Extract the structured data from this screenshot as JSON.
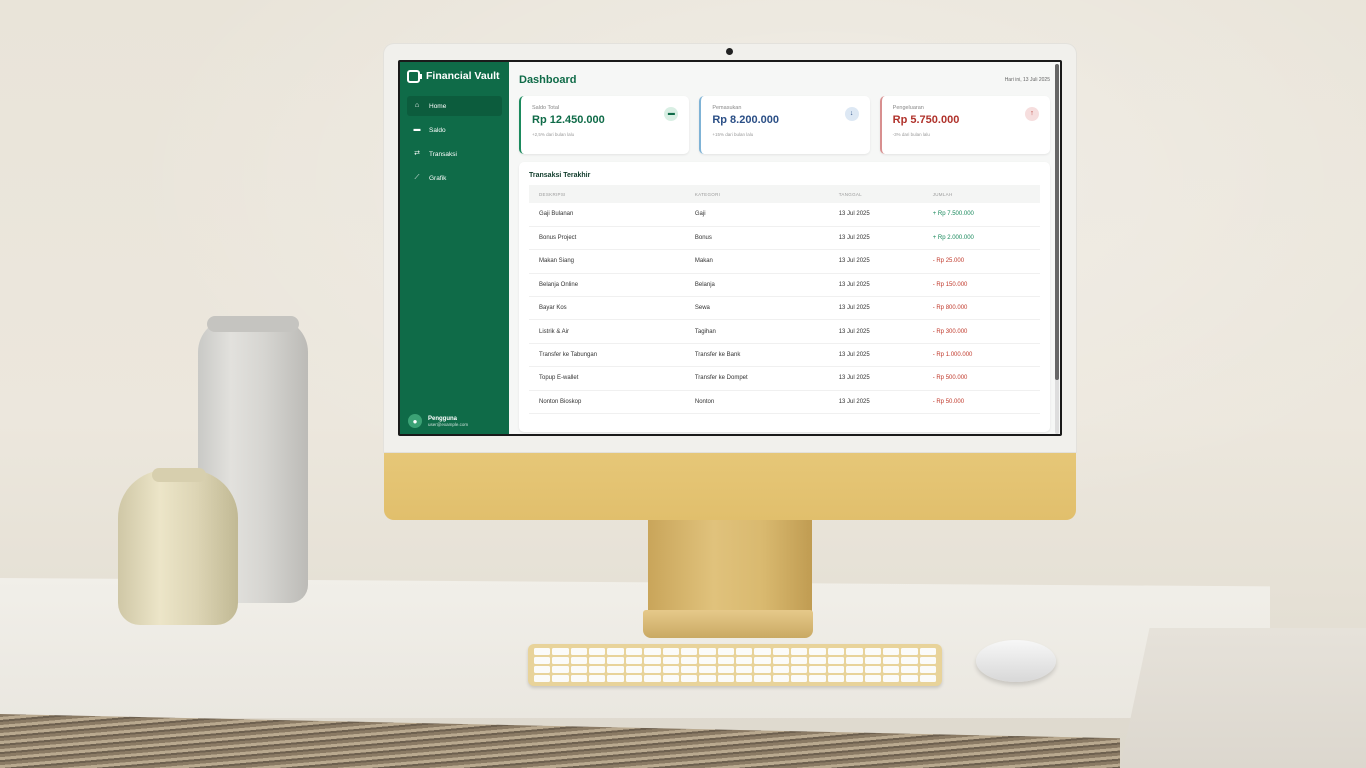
{
  "app": {
    "name": "Financial Vault",
    "page_title": "Dashboard",
    "date": "Hari ini, 13 Juli 2025"
  },
  "sidebar": {
    "items": [
      {
        "label": "Home",
        "icon": "home-icon",
        "active": true
      },
      {
        "label": "Saldo",
        "icon": "wallet-icon",
        "active": false
      },
      {
        "label": "Transaksi",
        "icon": "transfer-icon",
        "active": false
      },
      {
        "label": "Grafik",
        "icon": "chart-icon",
        "active": false
      }
    ],
    "user": {
      "name": "Pengguna",
      "email": "user@example.com"
    }
  },
  "cards": [
    {
      "label": "Saldo Total",
      "value": "Rp 12.450.000",
      "note": "+2,5% dari bulan lalu",
      "icon": "wallet-icon"
    },
    {
      "label": "Pemasukan",
      "value": "Rp 8.200.000",
      "note": "+15% dari bulan lalu",
      "icon": "arrow-down-icon"
    },
    {
      "label": "Pengeluaran",
      "value": "Rp 5.750.000",
      "note": "-3% dari bulan lalu",
      "icon": "arrow-up-icon"
    }
  ],
  "transactions": {
    "title": "Transaksi Terakhir",
    "columns": [
      "DESKRIPSI",
      "KATEGORI",
      "TANGGAL",
      "JUMLAH"
    ],
    "rows": [
      {
        "desc": "Gaji Bulanan",
        "category": "Gaji",
        "date": "13 Jul 2025",
        "amount": "+ Rp  7.500.000",
        "type": "pos"
      },
      {
        "desc": "Bonus Project",
        "category": "Bonus",
        "date": "13 Jul 2025",
        "amount": "+ Rp  2.000.000",
        "type": "pos"
      },
      {
        "desc": "Makan Siang",
        "category": "Makan",
        "date": "13 Jul 2025",
        "amount": "- Rp  25.000",
        "type": "neg"
      },
      {
        "desc": "Belanja Online",
        "category": "Belanja",
        "date": "13 Jul 2025",
        "amount": "- Rp  150.000",
        "type": "neg"
      },
      {
        "desc": "Bayar Kos",
        "category": "Sewa",
        "date": "13 Jul 2025",
        "amount": "- Rp  800.000",
        "type": "neg"
      },
      {
        "desc": "Listrik & Air",
        "category": "Tagihan",
        "date": "13 Jul 2025",
        "amount": "- Rp  300.000",
        "type": "neg"
      },
      {
        "desc": "Transfer ke Tabungan",
        "category": "Transfer ke Bank",
        "date": "13 Jul 2025",
        "amount": "- Rp  1.000.000",
        "type": "neg"
      },
      {
        "desc": "Topup E-wallet",
        "category": "Transfer ke Dompet",
        "date": "13 Jul 2025",
        "amount": "- Rp  500.000",
        "type": "neg"
      },
      {
        "desc": "Nonton Bioskop",
        "category": "Nonton",
        "date": "13 Jul 2025",
        "amount": "- Rp  50.000",
        "type": "neg"
      }
    ]
  },
  "colors": {
    "brand": "#0f6b48",
    "positive": "#1b8a5d",
    "negative": "#c0392b",
    "income": "#2b4f86"
  }
}
